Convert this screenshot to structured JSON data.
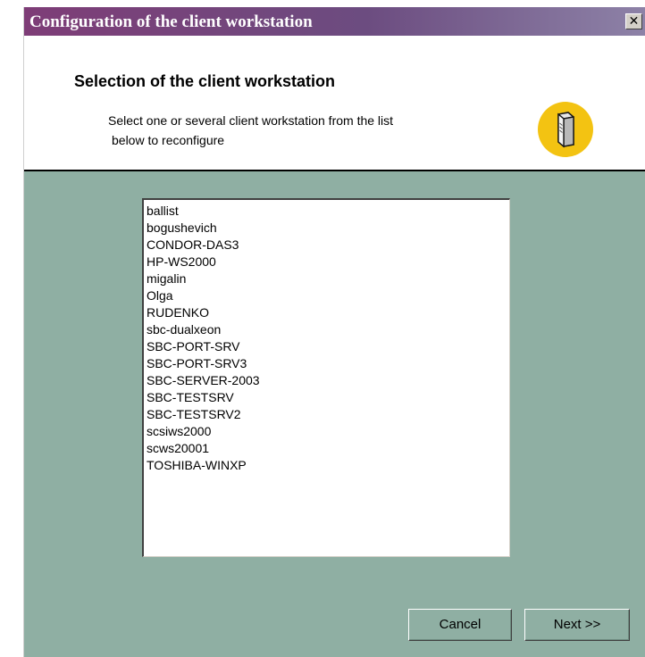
{
  "window": {
    "title": "Configuration of the client workstation",
    "close_symbol": "✕"
  },
  "header": {
    "title": "Selection of the client workstation",
    "description_line1": "Select one or several client workstation from the list",
    "description_line2": "below to reconfigure",
    "icon": "server-icon"
  },
  "workstations": [
    "ballist",
    "bogushevich",
    "CONDOR-DAS3",
    "HP-WS2000",
    "migalin",
    "Olga",
    "RUDENKO",
    "sbc-dualxeon",
    "SBC-PORT-SRV",
    "SBC-PORT-SRV3",
    "SBC-SERVER-2003",
    "SBC-TESTSRV",
    "SBC-TESTSRV2",
    "scsiws2000",
    "scws20001",
    "TOSHIBA-WINXP"
  ],
  "buttons": {
    "cancel": "Cancel",
    "next": "Next >>"
  },
  "colors": {
    "title_bar_start": "#7e3d77",
    "title_bar_end": "#8d82a7",
    "dialog_background": "#8fafa3",
    "icon_badge": "#f3c312"
  }
}
